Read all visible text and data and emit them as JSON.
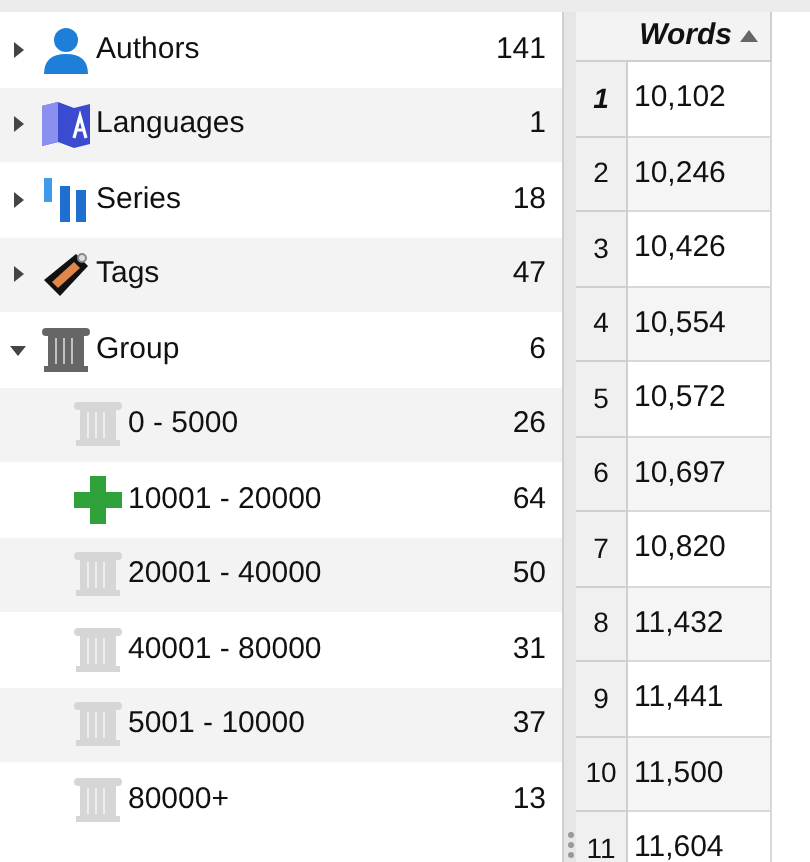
{
  "tree": [
    {
      "label": "Authors",
      "count": "141",
      "kind": "person",
      "expanded": false
    },
    {
      "label": "Languages",
      "count": "1",
      "kind": "languages",
      "expanded": false
    },
    {
      "label": "Series",
      "count": "18",
      "kind": "series",
      "expanded": false
    },
    {
      "label": "Tags",
      "count": "47",
      "kind": "tag",
      "expanded": false
    },
    {
      "label": "Group",
      "count": "6",
      "kind": "pillar",
      "expanded": true,
      "children": [
        {
          "label": "0 - 5000",
          "count": "26",
          "kind": "subgroup"
        },
        {
          "label": "10001 - 20000",
          "count": "64",
          "kind": "plus"
        },
        {
          "label": "20001 - 40000",
          "count": "50",
          "kind": "subgroup"
        },
        {
          "label": "40001 - 80000",
          "count": "31",
          "kind": "subgroup"
        },
        {
          "label": "5001 - 10000",
          "count": "37",
          "kind": "subgroup"
        },
        {
          "label": "80000+",
          "count": "13",
          "kind": "subgroup"
        }
      ]
    }
  ],
  "table": {
    "columns": [
      {
        "label": "Words",
        "sorted": true
      }
    ],
    "rows": [
      {
        "number": "1",
        "words": "10,102",
        "selected": true
      },
      {
        "number": "2",
        "words": "10,246",
        "selected": false
      },
      {
        "number": "3",
        "words": "10,426",
        "selected": false
      },
      {
        "number": "4",
        "words": "10,554",
        "selected": false
      },
      {
        "number": "5",
        "words": "10,572",
        "selected": false
      },
      {
        "number": "6",
        "words": "10,697",
        "selected": false
      },
      {
        "number": "7",
        "words": "10,820",
        "selected": false
      },
      {
        "number": "8",
        "words": "11,432",
        "selected": false
      },
      {
        "number": "9",
        "words": "11,441",
        "selected": false
      },
      {
        "number": "10",
        "words": "11,500",
        "selected": false
      },
      {
        "number": "11",
        "words": "11,604",
        "selected": false
      }
    ]
  }
}
